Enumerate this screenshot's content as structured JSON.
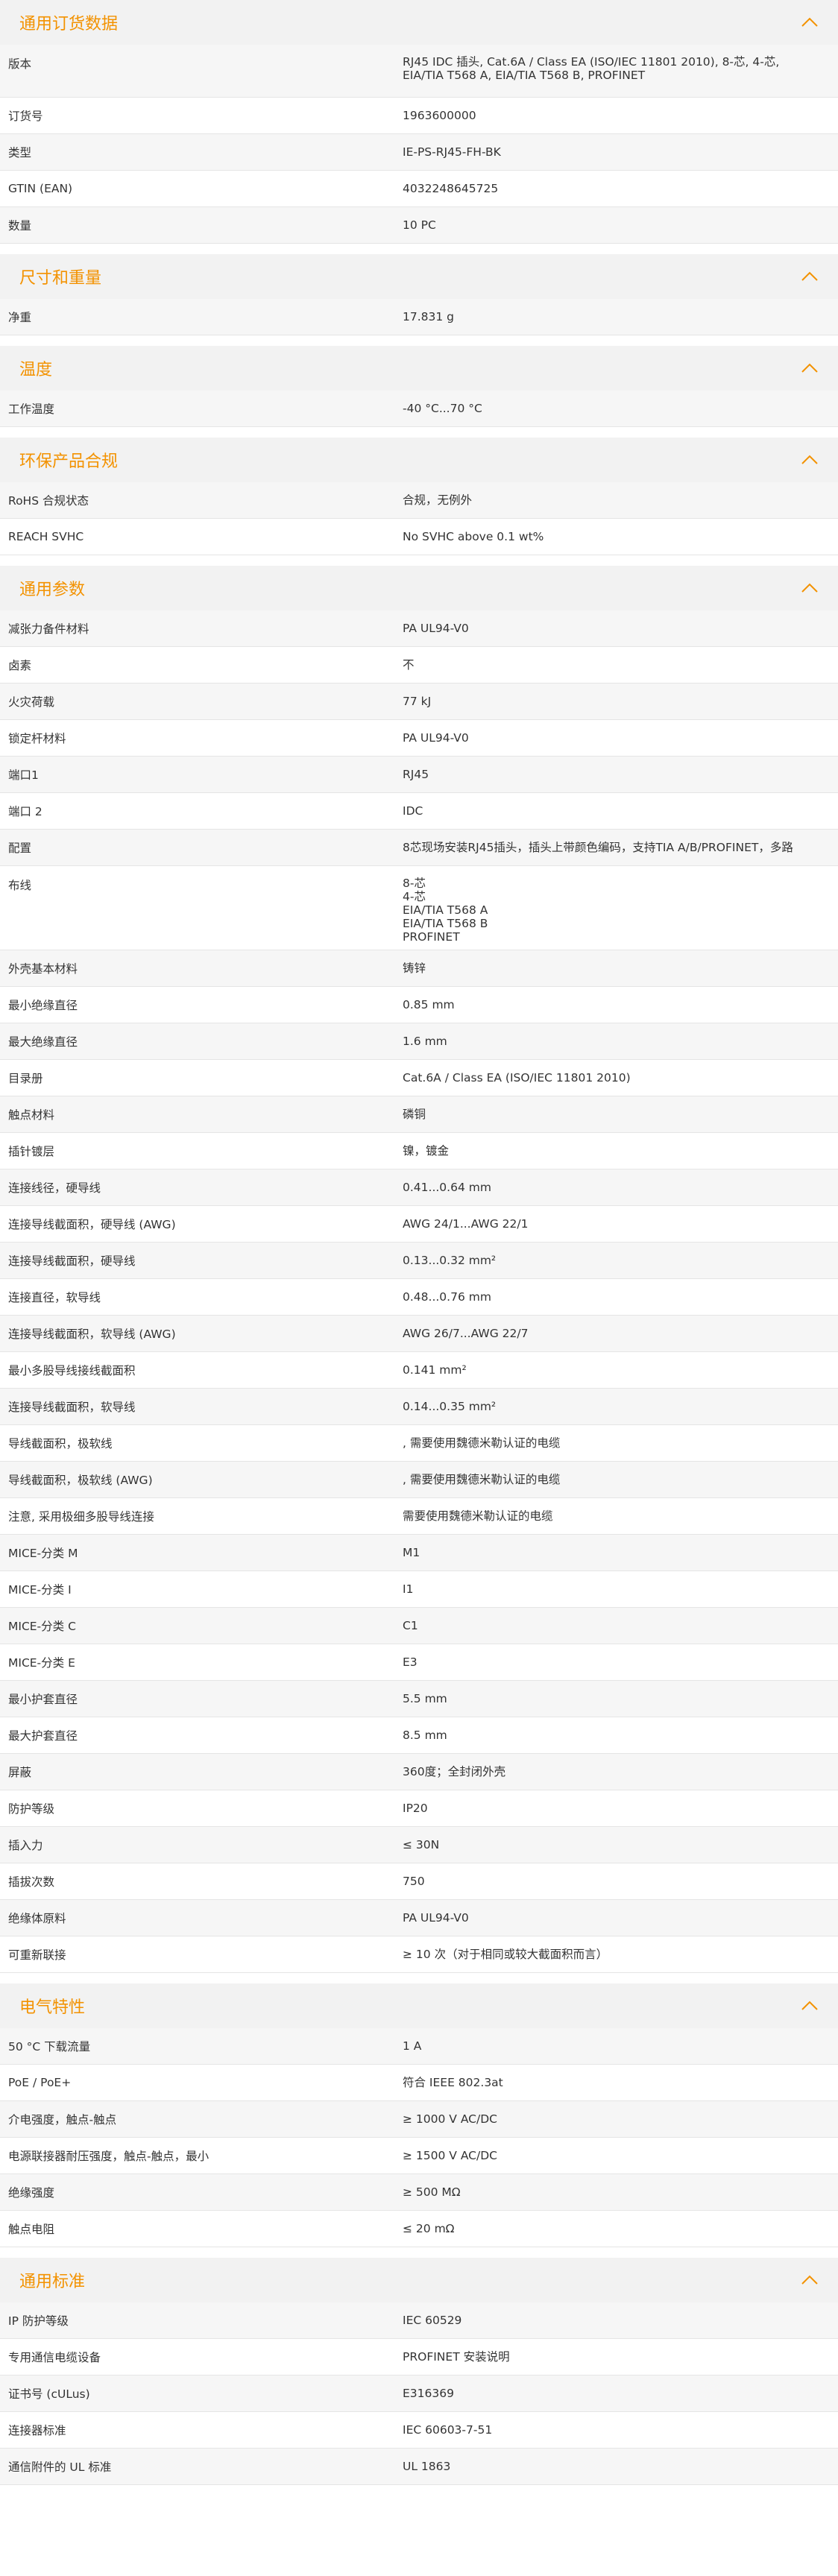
{
  "accent_color": "#f39200",
  "sections": [
    {
      "title": "通用订货数据",
      "rows": [
        {
          "k": "版本",
          "v": "RJ45 IDC 插头, Cat.6A / Class EA (ISO/IEC 11801 2010), 8-芯, 4-芯, EIA/TIA T568 A, EIA/TIA T568 B, PROFINET"
        },
        {
          "k": "订货号",
          "v": "1963600000"
        },
        {
          "k": "类型",
          "v": "IE-PS-RJ45-FH-BK"
        },
        {
          "k": "GTIN (EAN)",
          "v": "4032248645725"
        },
        {
          "k": "数量",
          "v": "10  PC"
        }
      ]
    },
    {
      "title": "尺寸和重量",
      "rows": [
        {
          "k": "净重",
          "v": "17.831  g"
        }
      ]
    },
    {
      "title": "温度",
      "rows": [
        {
          "k": "工作温度",
          "v": "-40 °C...70 °C"
        }
      ]
    },
    {
      "title": "环保产品合规",
      "rows": [
        {
          "k": "RoHS 合规状态",
          "v": "合规，无例外"
        },
        {
          "k": "REACH SVHC",
          "v": "No SVHC above 0.1 wt%"
        }
      ]
    },
    {
      "title": "通用参数",
      "rows": [
        {
          "k": "减张力备件材料",
          "v": "PA UL94-V0"
        },
        {
          "k": "卤素",
          "v": "不"
        },
        {
          "k": "火灾荷载",
          "v": "77  kJ"
        },
        {
          "k": "锁定杆材料",
          "v": "PA UL94-V0"
        },
        {
          "k": "端口1",
          "v": "RJ45"
        },
        {
          "k": "端口 2",
          "v": "IDC"
        },
        {
          "k": "配置",
          "v": "8芯现场安装RJ45插头，插头上带颜色编码，支持TIA A/B/PROFINET，多路"
        },
        {
          "k": "布线",
          "lines": [
            "8-芯",
            "4-芯",
            "EIA/TIA T568 A",
            "EIA/TIA T568 B",
            "PROFINET"
          ]
        },
        {
          "k": "外壳基本材料",
          "v": "铸锌"
        },
        {
          "k": "最小绝缘直径",
          "v": "0.85  mm"
        },
        {
          "k": "最大绝缘直径",
          "v": "1.6  mm"
        },
        {
          "k": "目录册",
          "v": "Cat.6A / Class EA (ISO/IEC 11801 2010)"
        },
        {
          "k": "触点材料",
          "v": "磷铜"
        },
        {
          "k": "插针镀层",
          "v": "镍，镀金"
        },
        {
          "k": "连接线径，硬导线",
          "v": "0.41...0.64 mm"
        },
        {
          "k": "连接导线截面积，硬导线 (AWG)",
          "v": "AWG 24/1...AWG 22/1"
        },
        {
          "k": "连接导线截面积，硬导线",
          "v": "0.13...0.32 mm²"
        },
        {
          "k": "连接直径，软导线",
          "v": "0.48...0.76 mm"
        },
        {
          "k": "连接导线截面积，软导线 (AWG)",
          "v": "AWG 26/7...AWG 22/7"
        },
        {
          "k": "最小多股导线接线截面积",
          "v": "0.141  mm²"
        },
        {
          "k": "连接导线截面积，软导线",
          "v": "0.14...0.35 mm²"
        },
        {
          "k": "导线截面积，极软线",
          "v": ", 需要使用魏德米勒认证的电缆"
        },
        {
          "k": "导线截面积，极软线 (AWG)",
          "v": ", 需要使用魏德米勒认证的电缆"
        },
        {
          "k": "注意, 采用极细多股导线连接",
          "v": "需要使用魏德米勒认证的电缆"
        },
        {
          "k": "MICE-分类 M",
          "v": "M1"
        },
        {
          "k": "MICE-分类 I",
          "v": "I1"
        },
        {
          "k": "MICE-分类 C",
          "v": "C1"
        },
        {
          "k": "MICE-分类 E",
          "v": "E3"
        },
        {
          "k": "最小护套直径",
          "v": "5.5  mm"
        },
        {
          "k": "最大护套直径",
          "v": "8.5  mm"
        },
        {
          "k": "屏蔽",
          "v": "360度；全封闭外壳"
        },
        {
          "k": "防护等级",
          "v": "IP20"
        },
        {
          "k": "插入力",
          "v": "≤ 30N"
        },
        {
          "k": "插拔次数",
          "v": "750"
        },
        {
          "k": "绝缘体原料",
          "v": "PA UL94-V0"
        },
        {
          "k": "可重新联接",
          "v": "≥ 10 次（对于相同或较大截面积而言）"
        }
      ]
    },
    {
      "title": "电气特性",
      "rows": [
        {
          "k": "50 °C 下载流量",
          "v": "1  A"
        },
        {
          "k": "PoE / PoE+",
          "v": "符合 IEEE 802.3at"
        },
        {
          "k": "介电强度，触点-触点",
          "v": "≥ 1000 V AC/DC"
        },
        {
          "k": "电源联接器耐压强度，触点-触点，最小",
          "v": "≥ 1500 V AC/DC"
        },
        {
          "k": "绝缘强度",
          "v": "≥ 500 MΩ"
        },
        {
          "k": "触点电阻",
          "v": "≤ 20 mΩ"
        }
      ]
    },
    {
      "title": "通用标准",
      "rows": [
        {
          "k": "IP 防护等级",
          "v": "IEC 60529"
        },
        {
          "k": "专用通信电缆设备",
          "v": "PROFINET 安装说明"
        },
        {
          "k": "证书号 (cULus)",
          "v": "E316369"
        },
        {
          "k": "连接器标准",
          "v": "IEC 60603-7-51"
        },
        {
          "k": "通信附件的 UL 标准",
          "v": "UL 1863"
        }
      ]
    }
  ]
}
